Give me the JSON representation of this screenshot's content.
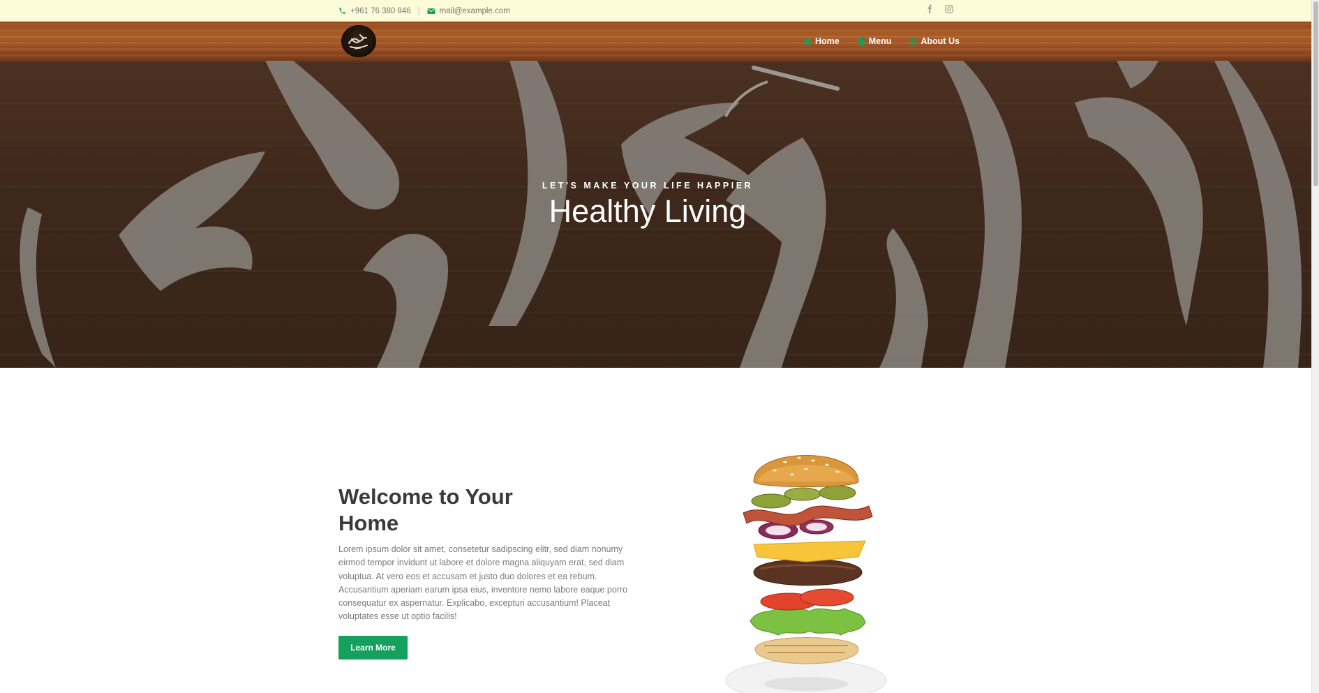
{
  "topbar": {
    "phone": "+961 76 380 846",
    "separator": "|",
    "email": "mail@example.com",
    "social": [
      "facebook-icon",
      "instagram-icon"
    ]
  },
  "header": {
    "logo": "restaurant-logo",
    "nav": [
      {
        "label": "Home",
        "icon": "home-icon"
      },
      {
        "label": "Menu",
        "icon": "file-icon"
      },
      {
        "label": "About Us",
        "icon": "paw-icon"
      }
    ]
  },
  "hero": {
    "subtitle": "LET'S MAKE YOUR LIFE HAPPIER",
    "title": "Healthy Living"
  },
  "welcome": {
    "title_line1": "Welcome to Your",
    "title_line2": "Home",
    "body": "Lorem ipsum dolor sit amet, consetetur sadipscing elitr, sed diam nonumy eirmod tempor invidunt ut labore et dolore magna aliquyam erat, sed diam voluptua. At vero eos et accusam et justo duo dolores et ea rebum. Accusantium aperiam earum ipsa eius, inventore nemo labore eaque porro consequatur ex aspernatur. Explicabo, excepturi accusantium! Placeat voluptates esse ut optio facilis!",
    "button_label": "Learn More"
  },
  "colors": {
    "accent": "#16a05d",
    "topbar_bg": "#fdfbd8",
    "wood": "#a7582a"
  }
}
